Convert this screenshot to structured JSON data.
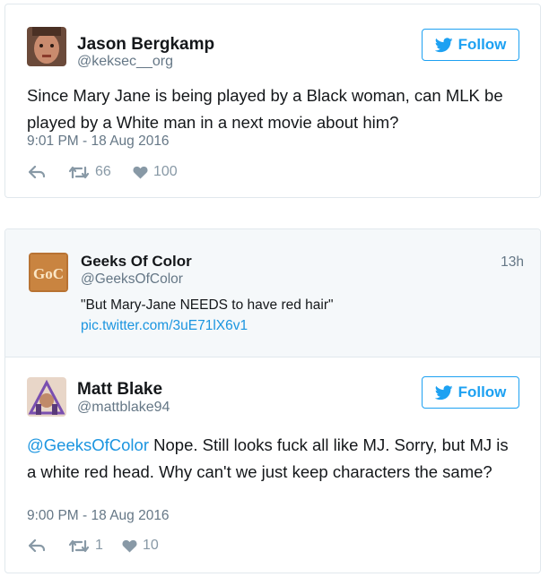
{
  "tweet1": {
    "name": "Jason Bergkamp",
    "handle": "@keksec__org",
    "follow_label": "Follow",
    "text": "Since Mary Jane is being played by a Black woman, can MLK be played by a White man in a next movie about him?",
    "timestamp": "9:01 PM - 18 Aug 2016",
    "retweets": "66",
    "likes": "100"
  },
  "quoted": {
    "logo_text": "GoC",
    "name": "Geeks Of Color",
    "handle": "@GeeksOfColor",
    "time": "13h",
    "text": "\"But Mary-Jane NEEDS to have red hair\"",
    "link": "pic.twitter.com/3uE71lX6v1"
  },
  "tweet2": {
    "name": "Matt Blake",
    "handle": "@mattblake94",
    "follow_label": "Follow",
    "mention": "@GeeksOfColor",
    "text": " Nope. Still looks fuck all like MJ. Sorry, but MJ is a white red head. Why can't we just keep characters the same?",
    "timestamp": "9:00 PM - 18 Aug 2016",
    "retweets": "1",
    "likes": "10"
  },
  "colors": {
    "brand": "#1da1f2",
    "link": "#1b95e0",
    "muted": "#657786",
    "action": "#8899a6"
  },
  "icons": [
    "twitter-bird-icon",
    "reply-icon",
    "retweet-icon",
    "heart-icon"
  ]
}
